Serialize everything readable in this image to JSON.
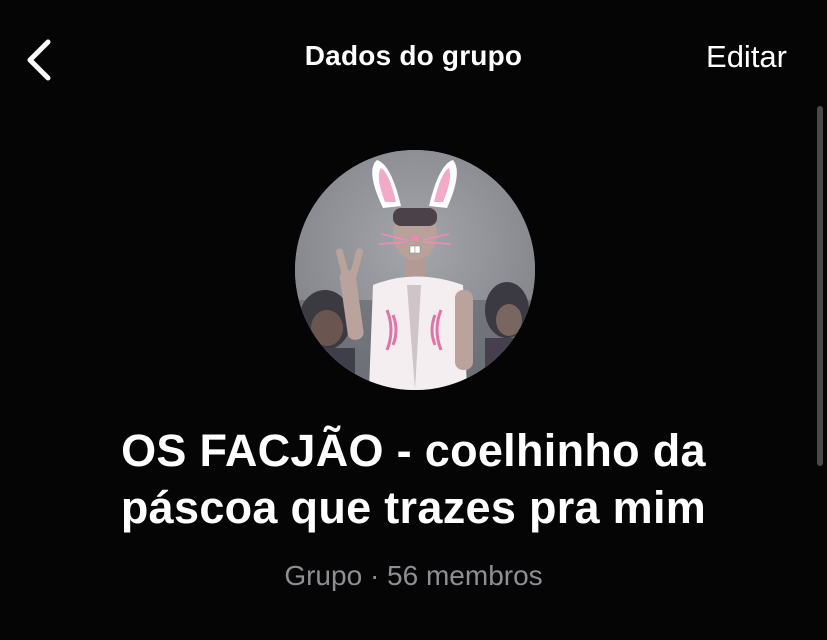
{
  "nav": {
    "back_icon": "chevron-left-icon",
    "title": "Dados do grupo",
    "edit_label": "Editar"
  },
  "group": {
    "avatar": "group-photo-bunny-ears",
    "name_line1": "OS FACJÃO - coelhinho da",
    "name_line2": "páscoa que trazes pra mim",
    "type_label": "Grupo",
    "separator": "·",
    "members_label": "56 membros"
  },
  "colors": {
    "background": "#050505",
    "text": "#ffffff",
    "secondary_text": "#8e8e93"
  }
}
